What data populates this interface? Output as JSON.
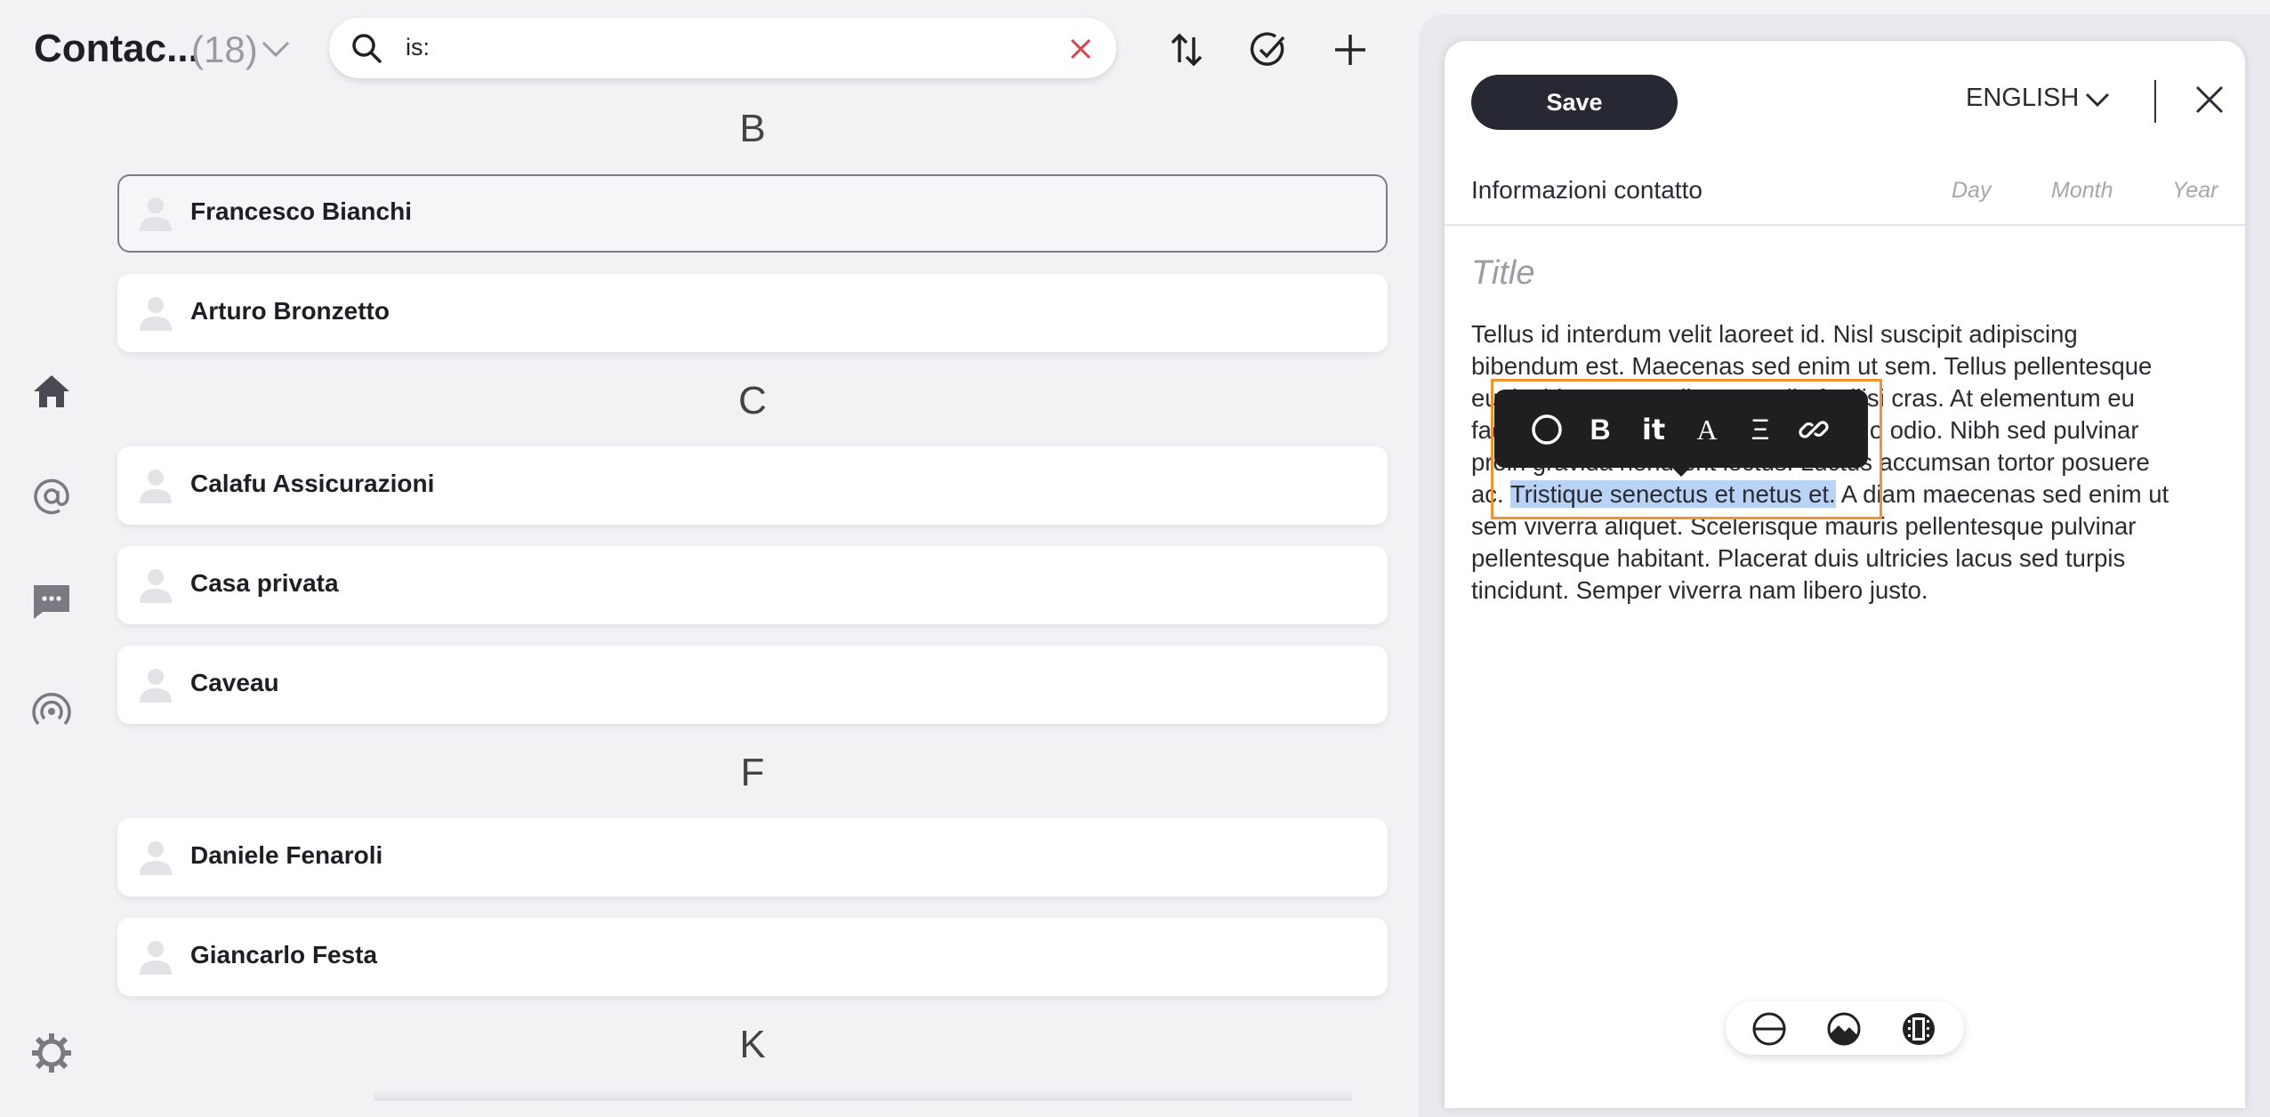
{
  "header": {
    "title": "Contac...",
    "count": "(18)",
    "search": {
      "value": "is:"
    }
  },
  "nav": {
    "icons": [
      "home-icon",
      "at-icon",
      "chat-icon",
      "broadcast-icon",
      "gear-icon"
    ]
  },
  "contacts": {
    "groups": [
      {
        "letter": "B",
        "items": [
          {
            "name": "Francesco Bianchi",
            "selected": true
          },
          {
            "name": "Arturo Bronzetto"
          }
        ]
      },
      {
        "letter": "C",
        "items": [
          {
            "name": "Calafu Assicurazioni"
          },
          {
            "name": "Casa privata"
          },
          {
            "name": "Caveau"
          }
        ]
      },
      {
        "letter": "F",
        "items": [
          {
            "name": "Daniele Fenaroli"
          },
          {
            "name": "Giancarlo Festa"
          }
        ]
      },
      {
        "letter": "K",
        "items": []
      }
    ]
  },
  "panel": {
    "save_label": "Save",
    "language": "ENGLISH",
    "section_title": "Informazioni contatto",
    "day_label": "Day",
    "month_label": "Month",
    "year_label": "Year",
    "title_placeholder": "Title",
    "body": {
      "line1": "Tellus id interdum velit laoreet id. Nisl suscipit adipiscing",
      "line2": "bibendum est. Maecenas sed enim ut sem. Tellus pellentesque",
      "line3": "eu tincidunt tortor aliquam nulla facilisi cras. At elementum eu",
      "line4": "facilisis sed odio morbi quis commodo odio. Nibh sed pulvinar",
      "line5": "proin gravida hendrerit lectus. Luctus accumsan tortor posuere",
      "line6_pre": "ac. ",
      "line6_selected": "Tristique senectus et netus et.",
      "line6_post": " A diam maecenas sed enim ut",
      "line7": "sem viverra aliquet. Scelerisque mauris pellentesque pulvinar",
      "line8": "pellentesque habitant. Placerat duis ultricies lacus sed turpis",
      "line9": "tincidunt. Semper viverra nam libero justo."
    },
    "format_toolbar": {
      "bold": "B",
      "italic": "it",
      "font": "A",
      "align": "Ξ"
    }
  },
  "colors": {
    "accent_focus": "#f2922a",
    "selection": "#b8d3f5",
    "danger": "#e0404a",
    "dark": "#262833"
  }
}
